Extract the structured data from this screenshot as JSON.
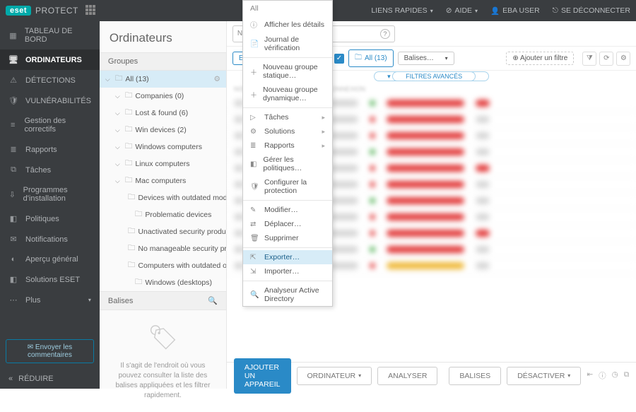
{
  "brand": {
    "eset": "eset",
    "protect": "PROTECT"
  },
  "top": {
    "quick": "LIENS RAPIDES",
    "help": "AIDE",
    "user": "EBA USER",
    "logout": "SE DÉCONNECTER"
  },
  "nav": {
    "items": [
      {
        "label": "TABLEAU DE BORD",
        "icon": "▦"
      },
      {
        "label": "ORDINATEURS",
        "icon": "🖥"
      },
      {
        "label": "DÉTECTIONS",
        "icon": "⚠"
      },
      {
        "label": "VULNÉRABILITÉS",
        "icon": "🛡"
      },
      {
        "label": "Gestion des correctifs",
        "icon": "≡"
      },
      {
        "label": "Rapports",
        "icon": "≣"
      },
      {
        "label": "Tâches",
        "icon": "⧉"
      },
      {
        "label": "Programmes d'installation",
        "icon": "⇩"
      },
      {
        "label": "Politiques",
        "icon": "◧"
      },
      {
        "label": "Notifications",
        "icon": "✉"
      },
      {
        "label": "Aperçu général",
        "icon": "◐"
      },
      {
        "label": "Solutions ESET",
        "icon": "◧"
      },
      {
        "label": "Plus",
        "icon": "⋯"
      }
    ],
    "feedback": "Envoyer les commentaires",
    "reduce": "RÉDUIRE"
  },
  "panel": {
    "title": "Ordinateurs",
    "groups": "Groupes",
    "balises": "Balises",
    "tags_hint": "Il s'agit de l'endroit où vous pouvez consulter la liste des balises appliquées et les filtrer rapidement.",
    "tree": [
      {
        "label": "All (13)",
        "depth": 0,
        "sel": true
      },
      {
        "label": "Companies (0)",
        "depth": 1
      },
      {
        "label": "Lost & found (6)",
        "depth": 1
      },
      {
        "label": "Win devices (2)",
        "depth": 1
      },
      {
        "label": "Windows computers",
        "depth": 1
      },
      {
        "label": "Linux computers",
        "depth": 1
      },
      {
        "label": "Mac computers",
        "depth": 1
      },
      {
        "label": "Devices with outdated modules",
        "depth": 2
      },
      {
        "label": "Problematic devices",
        "depth": 2
      },
      {
        "label": "Unactivated security product",
        "depth": 2
      },
      {
        "label": "No manageable security product",
        "depth": 2
      },
      {
        "label": "Computers with outdated operating s…",
        "depth": 2
      },
      {
        "label": "Windows (desktops)",
        "depth": 2
      }
    ]
  },
  "search": {
    "placeholder": "Nom de l'ordinateur"
  },
  "filters": {
    "subgroups": "ER LES SOUS-GROUPES",
    "all": "All (13)",
    "balises": "Balises…",
    "add": "Ajouter un filtre",
    "advanced": "FILTRES AVANCÉS"
  },
  "menu": {
    "header": "All",
    "items": [
      {
        "icon": "ⓘ",
        "label": "Afficher les détails"
      },
      {
        "icon": "📄",
        "label": "Journal de vérification"
      },
      {
        "sep": true
      },
      {
        "icon": "＋",
        "label": "Nouveau groupe statique…"
      },
      {
        "icon": "＋",
        "label": "Nouveau groupe dynamique…"
      },
      {
        "sep": true
      },
      {
        "icon": "▷",
        "label": "Tâches",
        "sub": true
      },
      {
        "icon": "⚙",
        "label": "Solutions",
        "sub": true
      },
      {
        "icon": "≣",
        "label": "Rapports",
        "sub": true
      },
      {
        "icon": "◧",
        "label": "Gérer les politiques…"
      },
      {
        "icon": "🛡",
        "label": "Configurer la protection"
      },
      {
        "sep": true
      },
      {
        "icon": "✎",
        "label": "Modifier…"
      },
      {
        "icon": "⇄",
        "label": "Déplacer…"
      },
      {
        "icon": "🗑",
        "label": "Supprimer"
      },
      {
        "sep": true
      },
      {
        "icon": "⇱",
        "label": "Exporter…",
        "hl": true
      },
      {
        "icon": "⇲",
        "label": "Importer…"
      },
      {
        "sep": true
      },
      {
        "icon": "🔍",
        "label": "Analyseur Active Directory"
      }
    ]
  },
  "footer": {
    "add": "AJOUTER UN APPAREIL",
    "computer": "ORDINATEUR",
    "analyze": "ANALYSER",
    "balises": "BALISES",
    "disable": "DÉSACTIVER"
  }
}
